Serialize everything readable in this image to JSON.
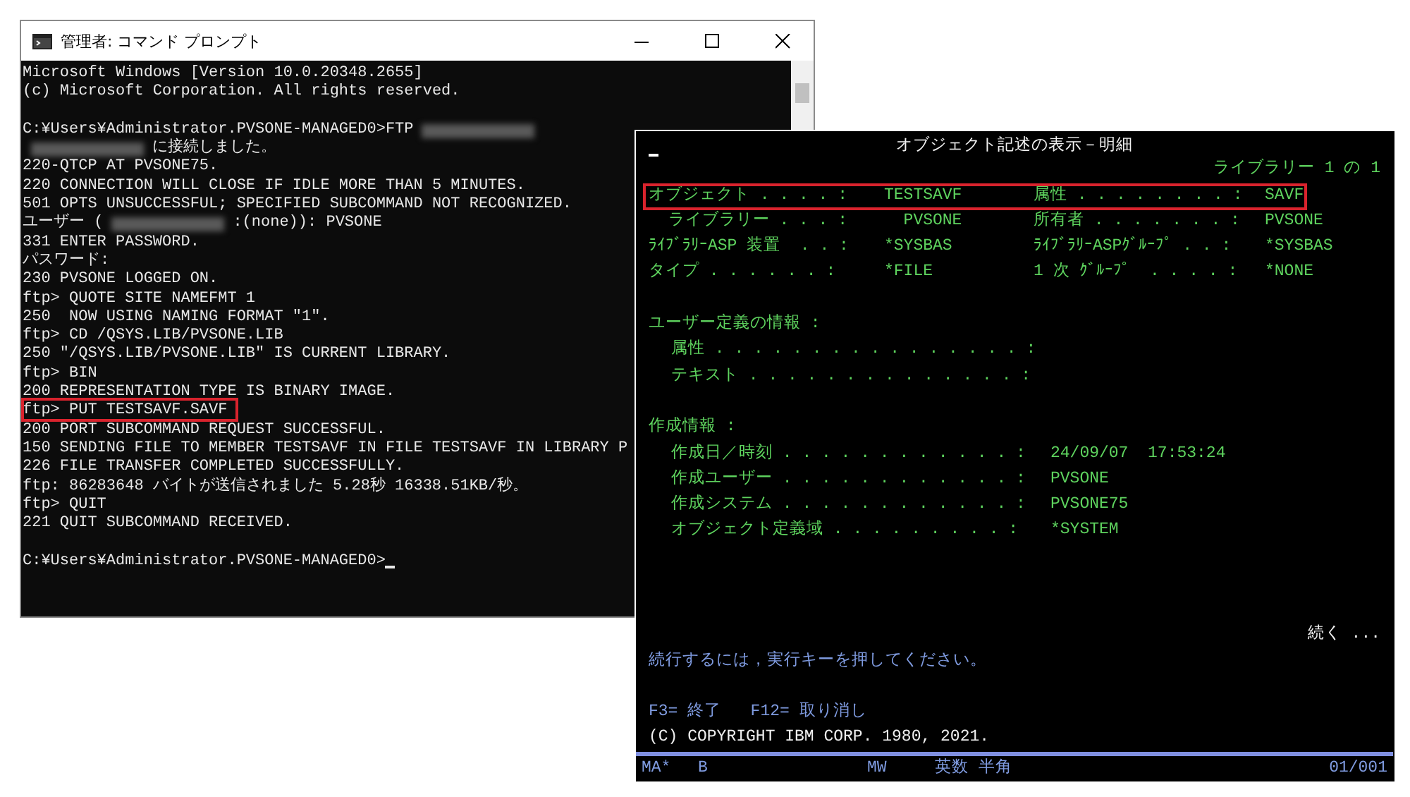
{
  "console_window": {
    "title": "管理者: コマンド プロンプト",
    "lines": [
      {
        "highlighted": false,
        "segments": [
          {
            "kind": "text",
            "text": "Microsoft Windows [Version 10.0.20348.2655]"
          }
        ]
      },
      {
        "highlighted": false,
        "segments": [
          {
            "kind": "text",
            "text": "(c) Microsoft Corporation. All rights reserved."
          }
        ]
      },
      {
        "highlighted": false
      },
      {
        "highlighted": false,
        "segments": [
          {
            "kind": "text",
            "text": "C:¥Users¥Administrator.PVSONE-MANAGED0>FTP"
          },
          {
            "kind": "redaction"
          }
        ]
      },
      {
        "highlighted": false,
        "segments": [
          {
            "kind": "redaction"
          },
          {
            "kind": "text",
            "text": "に接続しました。"
          }
        ]
      },
      {
        "highlighted": false,
        "segments": [
          {
            "kind": "text",
            "text": "220-QTCP AT PVSONE75."
          }
        ]
      },
      {
        "highlighted": false,
        "segments": [
          {
            "kind": "text",
            "text": "220 CONNECTION WILL CLOSE IF IDLE MORE THAN 5 MINUTES."
          }
        ]
      },
      {
        "highlighted": false,
        "segments": [
          {
            "kind": "text",
            "text": "501 OPTS UNSUCCESSFUL; SPECIFIED SUBCOMMAND NOT RECOGNIZED."
          }
        ]
      },
      {
        "highlighted": false,
        "segments": [
          {
            "kind": "text",
            "text": "ユーザー ("
          },
          {
            "kind": "redaction"
          },
          {
            "kind": "text",
            "text": ":(none)): PVSONE"
          }
        ]
      },
      {
        "highlighted": false,
        "segments": [
          {
            "kind": "text",
            "text": "331 ENTER PASSWORD."
          }
        ]
      },
      {
        "highlighted": false,
        "segments": [
          {
            "kind": "text",
            "text": "パスワード:"
          }
        ]
      },
      {
        "highlighted": false,
        "segments": [
          {
            "kind": "text",
            "text": "230 PVSONE LOGGED ON."
          }
        ]
      },
      {
        "highlighted": false,
        "segments": [
          {
            "kind": "text",
            "text": "ftp> QUOTE SITE NAMEFMT 1"
          }
        ]
      },
      {
        "highlighted": false,
        "segments": [
          {
            "kind": "text",
            "text": "250  NOW USING NAMING FORMAT \"1\"."
          }
        ]
      },
      {
        "highlighted": false,
        "segments": [
          {
            "kind": "text",
            "text": "ftp> CD /QSYS.LIB/PVSONE.LIB"
          }
        ]
      },
      {
        "highlighted": false,
        "segments": [
          {
            "kind": "text",
            "text": "250 \"/QSYS.LIB/PVSONE.LIB\" IS CURRENT LIBRARY."
          }
        ]
      },
      {
        "highlighted": false,
        "segments": [
          {
            "kind": "text",
            "text": "ftp> BIN"
          }
        ]
      },
      {
        "highlighted": false,
        "segments": [
          {
            "kind": "text",
            "text": "200 REPRESENTATION TYPE IS BINARY IMAGE."
          }
        ]
      },
      {
        "highlighted": true,
        "segments": [
          {
            "kind": "text",
            "text": "ftp> PUT TESTSAVF.SAVF"
          }
        ]
      },
      {
        "highlighted": false,
        "segments": [
          {
            "kind": "text",
            "text": "200 PORT SUBCOMMAND REQUEST SUCCESSFUL."
          }
        ]
      },
      {
        "highlighted": false,
        "segments": [
          {
            "kind": "text",
            "text": "150 SENDING FILE TO MEMBER TESTSAVF IN FILE TESTSAVF IN LIBRARY P"
          }
        ]
      },
      {
        "highlighted": false,
        "segments": [
          {
            "kind": "text",
            "text": "226 FILE TRANSFER COMPLETED SUCCESSFULLY."
          }
        ]
      },
      {
        "highlighted": false,
        "segments": [
          {
            "kind": "text",
            "text": "ftp: 86283648 バイトが送信されました 5.28秒 16338.51KB/秒。"
          }
        ]
      },
      {
        "highlighted": false,
        "segments": [
          {
            "kind": "text",
            "text": "ftp> QUIT"
          }
        ]
      },
      {
        "highlighted": false,
        "segments": [
          {
            "kind": "text",
            "text": "221 QUIT SUBCOMMAND RECEIVED."
          }
        ]
      },
      {
        "highlighted": false
      },
      {
        "highlighted": false,
        "segments": [
          {
            "kind": "text",
            "text": "C:¥Users¥Administrator.PVSONE-MANAGED0>"
          },
          {
            "kind": "cursor"
          }
        ]
      }
    ]
  },
  "terminal_window": {
    "title": "オブジェクト記述の表示－明細",
    "page_indicator": "ライブラリー 1 の 1",
    "attribute_rows": [
      {
        "highlighted": true,
        "label": "オブジェクト . . . . :",
        "value": "TESTSAVF",
        "label_2": "属性 . . . . . . . . :",
        "value_2": "SAVF"
      },
      {
        "highlighted": false,
        "label": "  ライブラリー . . . :",
        "value": "  PVSONE",
        "label_2": "所有者 . . . . . . . :",
        "value_2": "PVSONE"
      },
      {
        "highlighted": false,
        "label": "ﾗｲﾌﾞﾗﾘｰASP 装置  . . :",
        "value": "*SYSBAS",
        "label_2": "ﾗｲﾌﾞﾗﾘｰASPｸﾞﾙｰﾌﾟ . . :",
        "value_2": "*SYSBAS"
      },
      {
        "highlighted": false,
        "label": "タイプ . . . . . . :",
        "value": "*FILE",
        "label_2": "1 次 ｸﾞﾙｰﾌﾟ  . . . . :",
        "value_2": "*NONE"
      }
    ],
    "sections": [
      {
        "heading": "ユーザー定義の情報 :",
        "rows": [
          {
            "label": "属性 . . . . . . . . . . . . . . . . :"
          },
          {
            "label": "テキスト . . . . . . . . . . . . . . :"
          }
        ]
      },
      {
        "heading": "作成情報 :",
        "rows": [
          {
            "label": "作成日／時刻 . . . . . . . . . . . . :",
            "value": "24/09/07  17:53:24"
          },
          {
            "label": "作成ユーザー . . . . . . . . . . . . :",
            "value": "PVSONE"
          },
          {
            "label": "作成システム . . . . . . . . . . . . :",
            "value": "PVSONE75"
          },
          {
            "label": "オブジェクト定義域 . . . . . . . . . :",
            "value": "*SYSTEM"
          }
        ]
      }
    ],
    "more_indicator": "続く ...",
    "message": "続行するには，実行キーを押してください。",
    "function_keys": "F3= 終了   F12= 取り消し",
    "copyright": "(C) COPYRIGHT IBM CORP. 1980, 2021.",
    "status_bar": [
      "MA*",
      "B",
      "MW",
      "英数 半角",
      "01/001"
    ]
  }
}
